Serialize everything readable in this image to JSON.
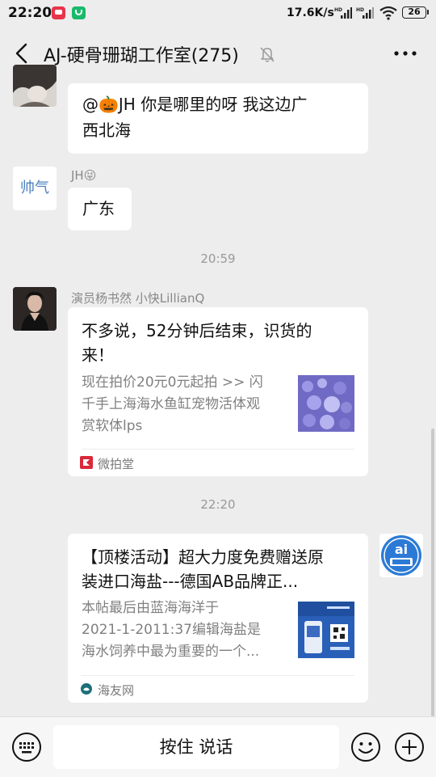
{
  "status_bar": {
    "time": "22:20",
    "network_speed": "17.6K/s",
    "signal_label": "HD",
    "battery": "26",
    "icons": [
      "red-app-icon",
      "green-app-icon",
      "hd-signal-icon",
      "hd-signal-icon",
      "wifi-icon",
      "battery-icon"
    ]
  },
  "header": {
    "title": "AJ-硬骨珊瑚工作室(275)",
    "icons": [
      "back-arrow-icon",
      "mute-bell-icon",
      "more-dots-icon"
    ]
  },
  "messages": [
    {
      "type": "text",
      "lines": [
        "@🎃JH  你是哪里的呀  我这边广",
        "西北海"
      ]
    },
    {
      "type": "text",
      "sender": "JH😜",
      "avatar_text": "帅气",
      "lines": [
        "广东"
      ]
    },
    {
      "type": "timestamp",
      "text": "20:59"
    },
    {
      "type": "card",
      "sender": "演员杨书然 小快LillianQ",
      "title_lines": [
        "不多说，52分钟后结束，识货的",
        "来！"
      ],
      "desc_lines": [
        "现在拍价20元0元起拍 >> 闪",
        "千手上海海水鱼缸宠物活体观",
        "赏软体lps"
      ],
      "source": "微拍堂"
    },
    {
      "type": "timestamp",
      "text": "22:20"
    },
    {
      "type": "card",
      "self": true,
      "title_lines": [
        "【顶楼活动】超大力度免费赠送原",
        "装进口海盐---德国AB品牌正..."
      ],
      "desc_lines": [
        "本帖最后由蓝海海洋于",
        "2021-1-2011:37编辑海盐是",
        "海水饲养中最为重要的一个..."
      ],
      "source": "海友网"
    }
  ],
  "input_bar": {
    "talk_label": "按住 说话",
    "icons": [
      "keyboard-icon",
      "emoji-icon",
      "plus-icon"
    ]
  },
  "colors": {
    "background": "#ededed",
    "bubble": "#ffffff",
    "secondary_text": "#888888",
    "weipaitang_red": "#d9283a"
  }
}
